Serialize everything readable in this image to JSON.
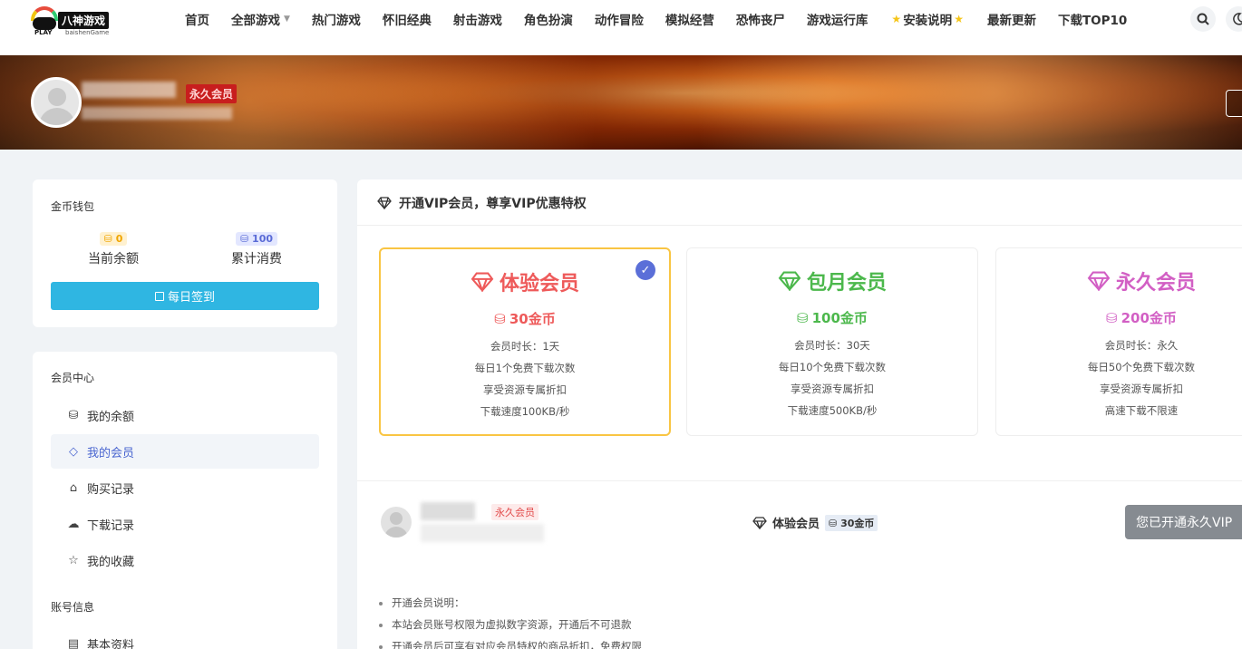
{
  "header": {
    "logo_text": "八神游戏",
    "logo_sub": "baishenGame",
    "logo_play": "PLAY",
    "nav": [
      {
        "label": "首页"
      },
      {
        "label": "全部游戏"
      },
      {
        "label": "热门游戏"
      },
      {
        "label": "怀旧经典"
      },
      {
        "label": "射击游戏"
      },
      {
        "label": "角色扮演"
      },
      {
        "label": "动作冒险"
      },
      {
        "label": "模拟经营"
      },
      {
        "label": "恐怖丧尸"
      },
      {
        "label": "游戏运行库"
      },
      {
        "label": "安装说明"
      },
      {
        "label": "最新更新"
      },
      {
        "label": "下载TOP10"
      }
    ]
  },
  "banner": {
    "vip_tag": "永久会员"
  },
  "wallet": {
    "title": "金币钱包",
    "balance_value": "0",
    "balance_label": "当前余额",
    "spent_value": "100",
    "spent_label": "累计消费",
    "checkin_label": "每日签到"
  },
  "menu": {
    "section_member": "会员中心",
    "items": [
      {
        "label": "我的余额"
      },
      {
        "label": "我的会员"
      },
      {
        "label": "购买记录"
      },
      {
        "label": "下载记录"
      },
      {
        "label": "我的收藏"
      }
    ],
    "section_account": "账号信息",
    "account_items": [
      {
        "label": "基本资料"
      }
    ]
  },
  "main": {
    "title": "开通VIP会员，尊享VIP优惠特权",
    "plans": [
      {
        "name": "体验会员",
        "price": "30金币",
        "features": [
          "会员时长：1天",
          "每日1个免费下载次数",
          "享受资源专属折扣",
          "下载速度100KB/秒"
        ]
      },
      {
        "name": "包月会员",
        "price": "100金币",
        "features": [
          "会员时长：30天",
          "每日10个免费下载次数",
          "享受资源专属折扣",
          "下载速度500KB/秒"
        ]
      },
      {
        "name": "永久会员",
        "price": "200金币",
        "features": [
          "会员时长：永久",
          "每日50个免费下载次数",
          "享受资源专属折扣",
          "高速下载不限速"
        ]
      }
    ],
    "user_tag": "永久会员",
    "current_plan": "体验会员",
    "current_price": "30金币",
    "already_button": "您已开通永久VIP",
    "notes": [
      "开通会员说明：",
      "本站会员账号权限为虚拟数字资源，开通后不可退款",
      "开通会员后可享有对应会员特权的商品折扣，免费权限"
    ]
  },
  "colors": {
    "accent_blue": "#2fb6e2",
    "trial": "#ee5a5a",
    "monthly": "#4cb84c",
    "permanent": "#d25fc4",
    "selected_border": "#f9c543"
  }
}
